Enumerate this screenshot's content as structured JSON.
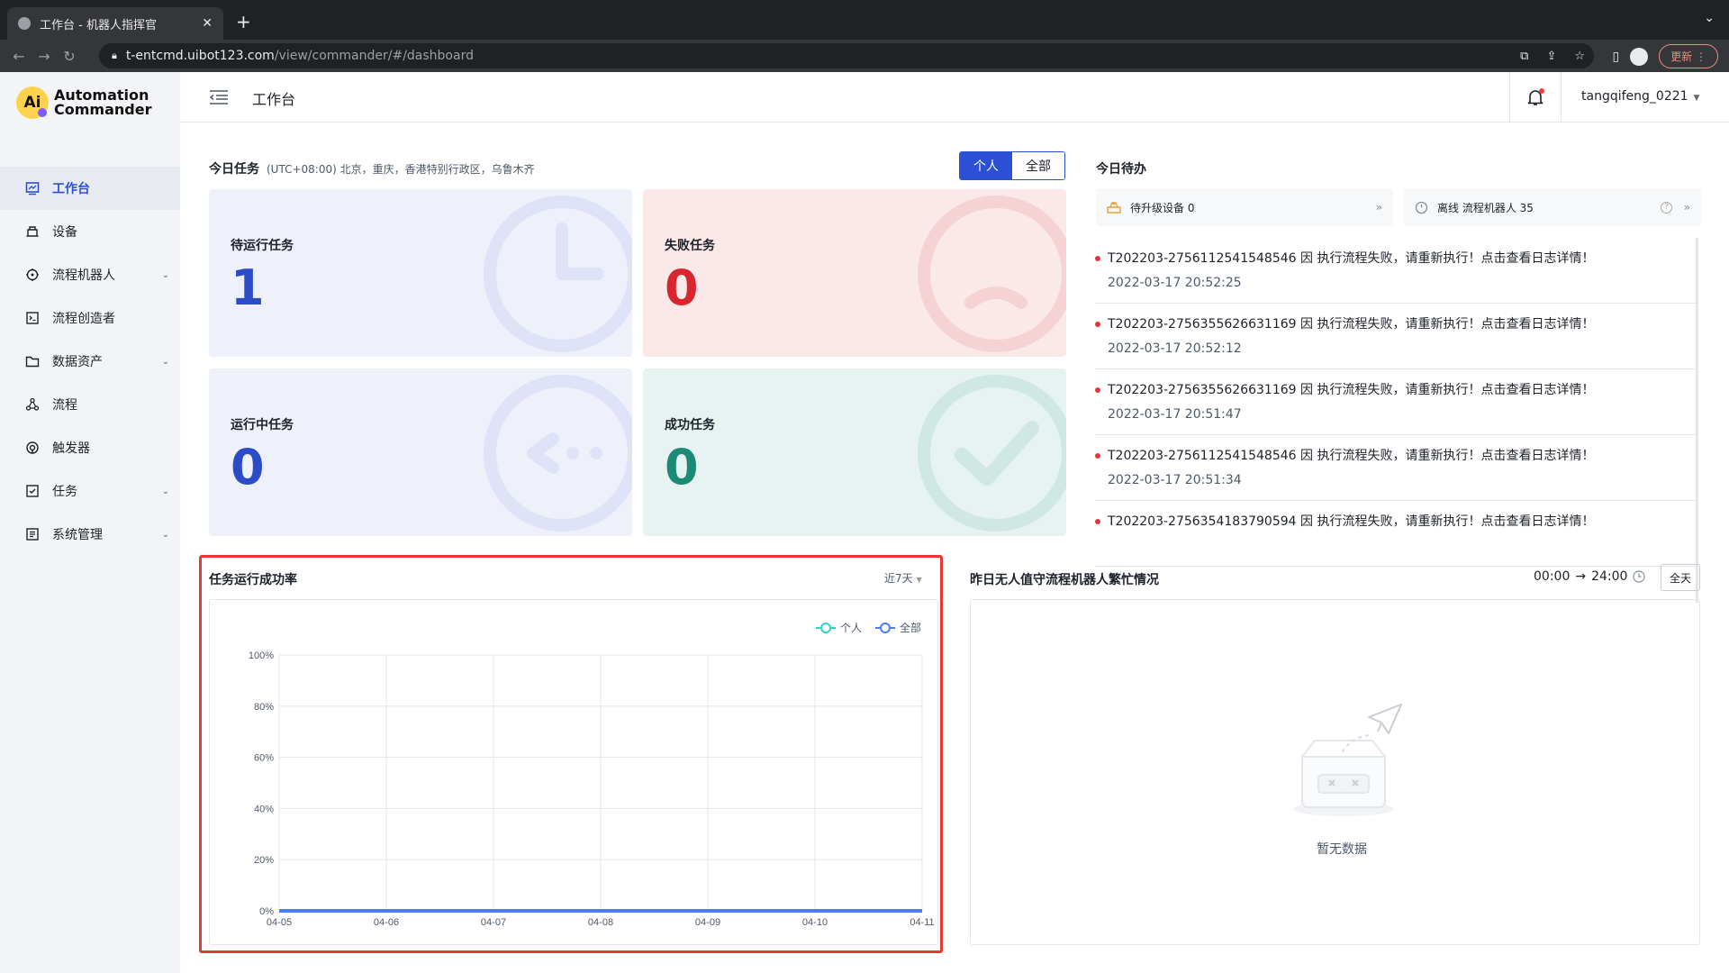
{
  "browser": {
    "tab_title": "工作台 - 机器人指挥官",
    "url_host": "t-entcmd.uibot123.com",
    "url_path": "/view/commander/#/dashboard",
    "update_label": "更新"
  },
  "brand": {
    "line1": "Automation",
    "line2": "Commander",
    "mark": "Ai"
  },
  "sidebar": {
    "items": [
      {
        "label": "工作台",
        "icon": "dashboard-icon",
        "active": true,
        "expandable": false
      },
      {
        "label": "设备",
        "icon": "device-icon",
        "active": false,
        "expandable": false
      },
      {
        "label": "流程机器人",
        "icon": "robot-icon",
        "active": false,
        "expandable": true
      },
      {
        "label": "流程创造者",
        "icon": "creator-icon",
        "active": false,
        "expandable": false
      },
      {
        "label": "数据资产",
        "icon": "folder-icon",
        "active": false,
        "expandable": true
      },
      {
        "label": "流程",
        "icon": "process-icon",
        "active": false,
        "expandable": false
      },
      {
        "label": "触发器",
        "icon": "trigger-icon",
        "active": false,
        "expandable": false
      },
      {
        "label": "任务",
        "icon": "task-icon",
        "active": false,
        "expandable": true
      },
      {
        "label": "系统管理",
        "icon": "settings-icon",
        "active": false,
        "expandable": true
      }
    ]
  },
  "header": {
    "title": "工作台",
    "username": "tangqifeng_0221"
  },
  "today_tasks": {
    "title": "今日任务",
    "timezone": "(UTC+08:00) 北京，重庆，香港特别行政区，乌鲁木齐",
    "scope_options": [
      "个人",
      "全部"
    ],
    "scope_selected": "个人",
    "cards": {
      "pending": {
        "label": "待运行任务",
        "value": "1"
      },
      "failed": {
        "label": "失败任务",
        "value": "0"
      },
      "running": {
        "label": "运行中任务",
        "value": "0"
      },
      "success": {
        "label": "成功任务",
        "value": "0"
      }
    }
  },
  "todo": {
    "title": "今日待办",
    "upgrade_box": "待升级设备 0",
    "offline_box": "离线 流程机器人 35",
    "notifications": [
      {
        "text": "T202203-2756112541548546 因 执行流程失败，请重新执行！点击查看日志详情！",
        "time": "2022-03-17 20:52:25"
      },
      {
        "text": "T202203-2756355626631169 因 执行流程失败，请重新执行！点击查看日志详情！",
        "time": "2022-03-17 20:52:12"
      },
      {
        "text": "T202203-2756355626631169 因 执行流程失败，请重新执行！点击查看日志详情！",
        "time": "2022-03-17 20:51:47"
      },
      {
        "text": "T202203-2756112541548546 因 执行流程失败，请重新执行！点击查看日志详情！",
        "time": "2022-03-17 20:51:34"
      },
      {
        "text": "T202203-2756354183790594 因 执行流程失败，请重新执行！点击查看日志详情！",
        "time": ""
      }
    ]
  },
  "success_rate": {
    "title": "任务运行成功率",
    "range_label": "近7天"
  },
  "chart_data": {
    "type": "line",
    "title": "任务运行成功率",
    "x": [
      "04-05",
      "04-06",
      "04-07",
      "04-08",
      "04-09",
      "04-10",
      "04-11"
    ],
    "y_ticks": [
      "0%",
      "20%",
      "40%",
      "60%",
      "80%",
      "100%"
    ],
    "ylim": [
      0,
      100
    ],
    "grid": true,
    "legend_position": "top-right",
    "series": [
      {
        "name": "个人",
        "color": "#36cfc9",
        "values": [
          0,
          0,
          0,
          0,
          0,
          0,
          0
        ]
      },
      {
        "name": "全部",
        "color": "#4d7cfe",
        "values": [
          0,
          0,
          0,
          0,
          0,
          0,
          0
        ]
      }
    ]
  },
  "busy": {
    "title": "昨日无人值守流程机器人繁忙情况",
    "start": "00:00",
    "arrow": "→",
    "end": "24:00",
    "allday_label": "全天",
    "empty_text": "暂无数据"
  },
  "colors": {
    "primary": "#2b50d6",
    "danger": "#d9252d",
    "success": "#1b8a76",
    "highlight_border": "#e53935"
  }
}
